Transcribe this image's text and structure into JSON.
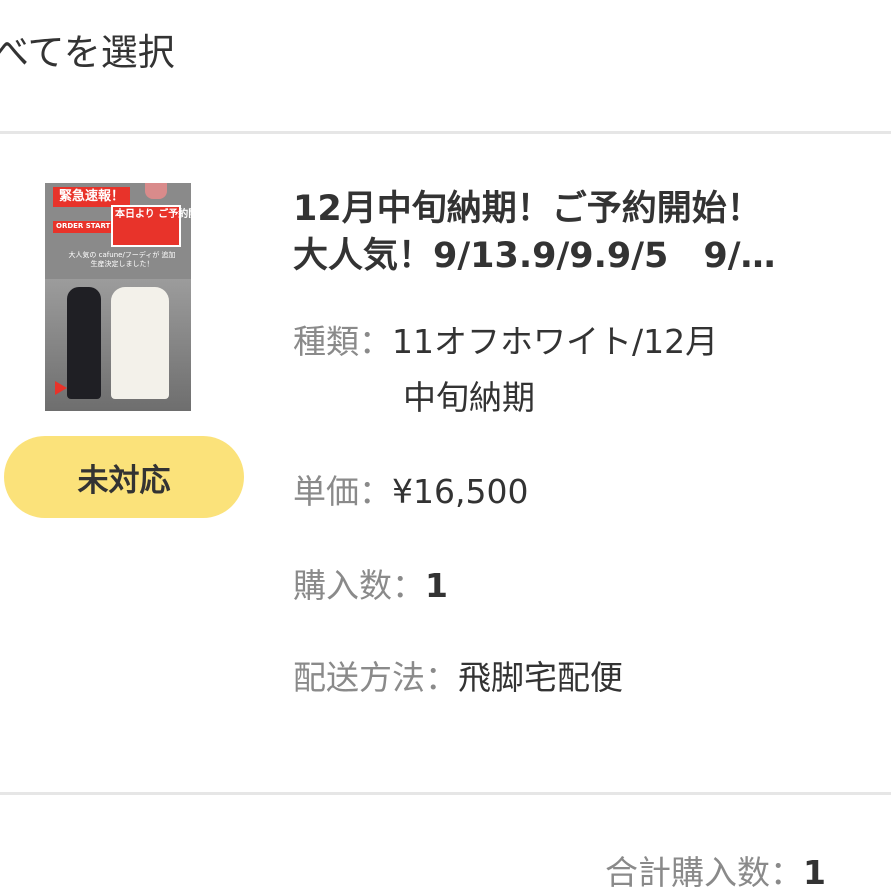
{
  "header": {
    "select_all_label": "べてを選択"
  },
  "item": {
    "thumbnail": {
      "banner_1": "緊急速報！",
      "banner_2": "本日より ご予約開始！",
      "banner_3": "ORDER START",
      "caption": "大人気の cafune/フーディが 追加生産決定しました！"
    },
    "status_badge": "未対応",
    "title_line_1": "12月中旬納期！ご予約開始！",
    "title_line_2": "大人気！9/13.9/9.9/5　9/…",
    "type_label": "種類：",
    "type_value_line_1": "11オフホワイト/12月",
    "type_value_line_2": "中旬納期",
    "price_label": "単価：",
    "price_value": "¥16,500",
    "qty_label": "購入数：",
    "qty_value": "1",
    "shipping_label": "配送方法：",
    "shipping_value": "飛脚宅配便"
  },
  "footer": {
    "total_qty_label": "合計購入数：",
    "total_qty_value": "1"
  },
  "colors": {
    "badge_bg": "#fbe27a",
    "divider": "#e6e6e6",
    "label_gray": "#8a8a8a",
    "text": "#333333"
  }
}
